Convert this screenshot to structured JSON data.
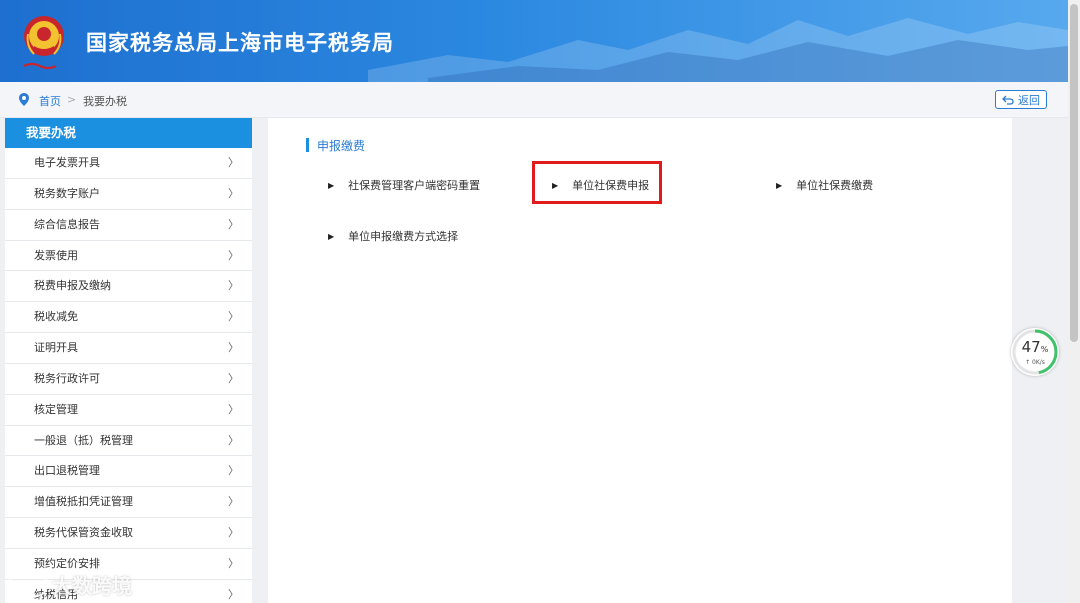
{
  "header": {
    "site_title": "国家税务总局上海市电子税务局",
    "emblem_icon": "tax-emblem-icon"
  },
  "breadcrumb": {
    "home": "首页",
    "separator": ">",
    "current": "我要办税",
    "back_label": "返回"
  },
  "sidebar": {
    "title": "我要办税",
    "items": [
      {
        "label": "电子发票开具",
        "chevron": "〉"
      },
      {
        "label": "税务数字账户",
        "chevron": "〉"
      },
      {
        "label": "综合信息报告",
        "chevron": "〉"
      },
      {
        "label": "发票使用",
        "chevron": "〉"
      },
      {
        "label": "税费申报及缴纳",
        "chevron": "〉"
      },
      {
        "label": "税收减免",
        "chevron": "〉"
      },
      {
        "label": "证明开具",
        "chevron": "〉"
      },
      {
        "label": "税务行政许可",
        "chevron": "〉"
      },
      {
        "label": "核定管理",
        "chevron": "〉"
      },
      {
        "label": "一般退（抵）税管理",
        "chevron": "〉"
      },
      {
        "label": "出口退税管理",
        "chevron": "〉"
      },
      {
        "label": "增值税抵扣凭证管理",
        "chevron": "〉"
      },
      {
        "label": "税务代保管资金收取",
        "chevron": "〉"
      },
      {
        "label": "预约定价安排",
        "chevron": "〉"
      },
      {
        "label": "纳税信用",
        "chevron": "〉"
      }
    ]
  },
  "main": {
    "section_title": "申报缴费",
    "links": [
      {
        "label": "社保费管理客户端密码重置"
      },
      {
        "label": "单位社保费申报"
      },
      {
        "label": "单位社保费缴费"
      },
      {
        "label": "单位申报缴费方式选择"
      }
    ],
    "bullet": "▶"
  },
  "speed_widget": {
    "percent": "47",
    "unit": "%",
    "rate": "↑ 0K/s"
  },
  "watermark": {
    "text": "大数跨境"
  },
  "colors": {
    "accent": "#1b8fe0",
    "link": "#2b7cd3",
    "highlight_box": "#e11b1b"
  }
}
